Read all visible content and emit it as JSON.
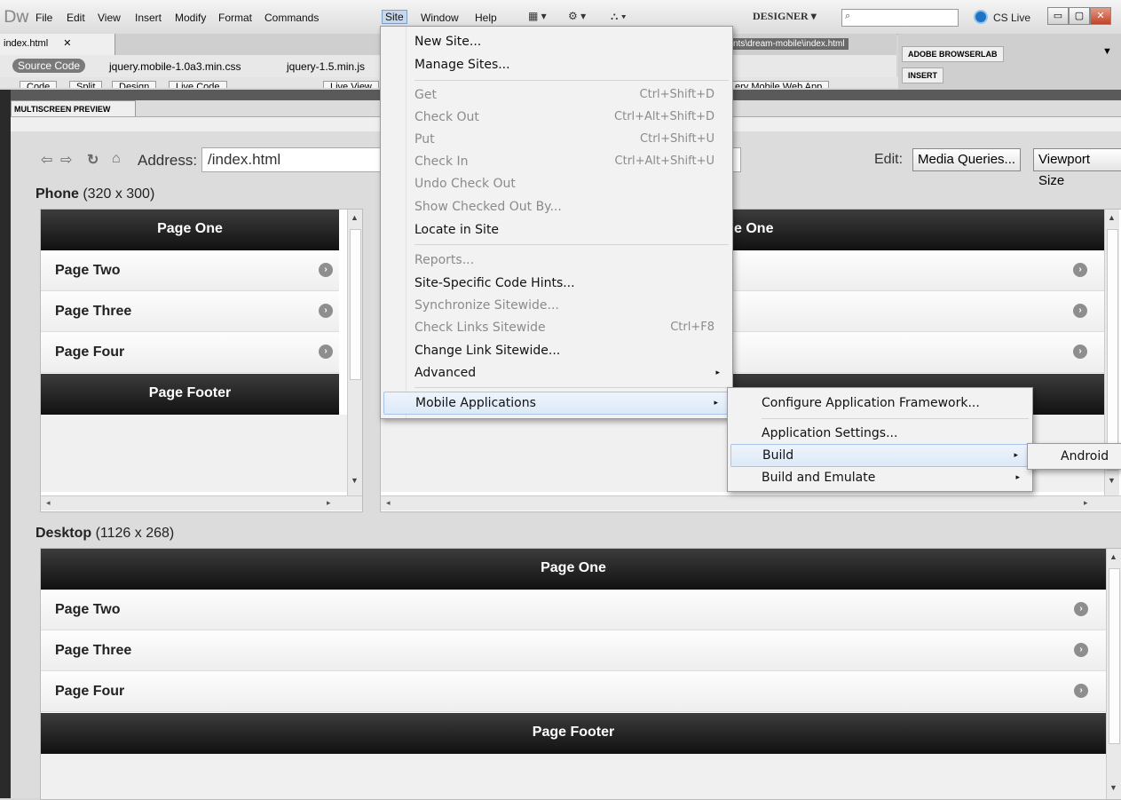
{
  "app": {
    "logo": "Dw"
  },
  "menubar": {
    "items": [
      "File",
      "Edit",
      "View",
      "Insert",
      "Modify",
      "Format",
      "Commands",
      "Site",
      "Window",
      "Help"
    ],
    "active": "Site",
    "workspace": "DESIGNER",
    "cslive": "CS Live"
  },
  "doc": {
    "tab": "index.html",
    "path": "nts\\dream-mobile\\index.html",
    "source_code": "Source Code",
    "related_files": [
      "jquery.mobile-1.0a3.min.css",
      "jquery-1.5.min.js"
    ],
    "view_buttons": [
      "Code",
      "Split",
      "Design",
      "Live Code",
      "Live View",
      "ery Mobile Web App"
    ]
  },
  "panels": {
    "browserlab": "ADOBE BROWSERLAB",
    "insert": "INSERT"
  },
  "multiscreen": {
    "tab": "MULTISCREEN PREVIEW",
    "address_label": "Address:",
    "address": "/index.html",
    "edit_label": "Edit:",
    "media_queries": "Media Queries...",
    "viewport_sizes": "Viewport Size",
    "phone": {
      "label": "Phone",
      "size": "(320 x 300)"
    },
    "desktop": {
      "label": "Desktop",
      "size": "(1126 x 268)"
    },
    "tablet_header_tail": "e One",
    "page": {
      "header": "Page One",
      "rows": [
        "Page Two",
        "Page Three",
        "Page Four"
      ],
      "footer": "Page Footer"
    }
  },
  "site_menu": {
    "items": [
      {
        "label": "New Site..."
      },
      {
        "label": "Manage Sites..."
      },
      {
        "label": "Get",
        "shortcut": "Ctrl+Shift+D",
        "disabled": true
      },
      {
        "label": "Check Out",
        "shortcut": "Ctrl+Alt+Shift+D",
        "disabled": true
      },
      {
        "label": "Put",
        "shortcut": "Ctrl+Shift+U",
        "disabled": true
      },
      {
        "label": "Check In",
        "shortcut": "Ctrl+Alt+Shift+U",
        "disabled": true
      },
      {
        "label": "Undo Check Out",
        "disabled": true
      },
      {
        "label": "Show Checked Out By...",
        "disabled": true
      },
      {
        "label": "Locate in Site"
      },
      {
        "label": "Reports...",
        "disabled": true
      },
      {
        "label": "Site-Specific Code Hints..."
      },
      {
        "label": "Synchronize Sitewide...",
        "disabled": true
      },
      {
        "label": "Check Links Sitewide",
        "shortcut": "Ctrl+F8",
        "disabled": true
      },
      {
        "label": "Change Link Sitewide..."
      },
      {
        "label": "Advanced",
        "submenu": true
      },
      {
        "label": "Mobile Applications",
        "submenu": true,
        "highlighted": true
      }
    ]
  },
  "mobile_menu": {
    "items": [
      {
        "label": "Configure Application Framework..."
      },
      {
        "label": "Application Settings..."
      },
      {
        "label": "Build",
        "submenu": true,
        "highlighted": true
      },
      {
        "label": "Build and Emulate",
        "submenu": true
      }
    ]
  },
  "build_menu": {
    "items": [
      {
        "label": "Android"
      }
    ]
  },
  "glyphs": {
    "submenu_arrow": "▸",
    "row_arrow": "›",
    "search": "⌕"
  },
  "colors": {
    "header_dark": "#111111",
    "menu_highlight": "#dde9f8",
    "cslive": "#1d73c2"
  }
}
